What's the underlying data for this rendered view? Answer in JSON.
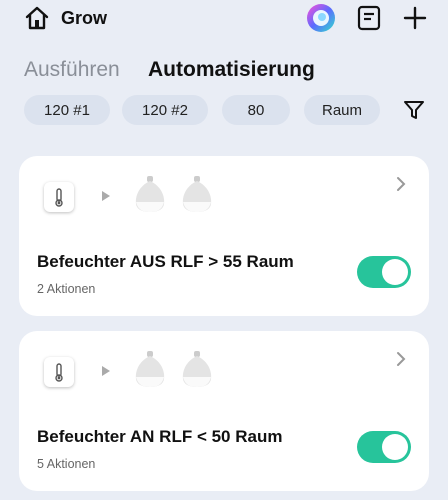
{
  "header": {
    "title": "Grow",
    "icons": [
      "home-icon",
      "assistant-icon",
      "log-icon",
      "add-icon"
    ]
  },
  "tabs": [
    {
      "label": "Ausführen",
      "active": false
    },
    {
      "label": "Automatisierung",
      "active": true
    }
  ],
  "filters": {
    "chips": [
      "120 #1",
      "120 #2",
      "80",
      "Raum"
    ],
    "filter_icon": "filter-icon"
  },
  "automations": [
    {
      "title": "Befeuchter AUS RLF > 55 Raum",
      "subtitle": "2 Aktionen",
      "enabled": true
    },
    {
      "title": "Befeuchter AN RLF < 50 Raum",
      "subtitle": "5 Aktionen",
      "enabled": true
    }
  ],
  "colors": {
    "background": "#e9edf5",
    "chip": "#dbe2ee",
    "toggle_on": "#27c49b",
    "inactive_tab": "#8a8f98"
  }
}
